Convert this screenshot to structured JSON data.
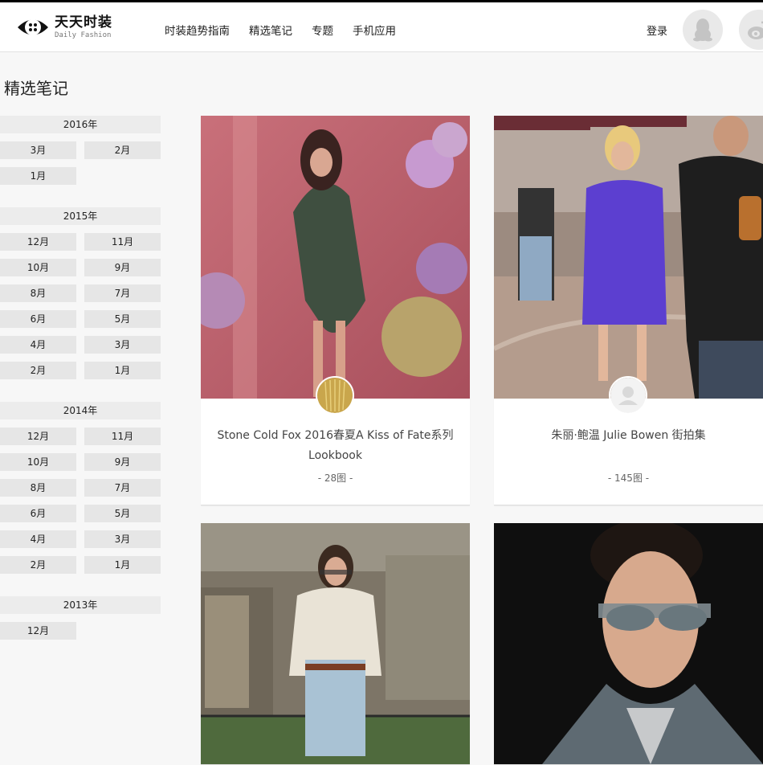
{
  "header": {
    "logo_cn": "天天时装",
    "logo_en": "Daily Fashion",
    "nav": [
      "时装趋势指南",
      "精选笔记",
      "专题",
      "手机应用"
    ],
    "login_label": "登录",
    "social_icons": [
      "qq-icon",
      "weibo-icon"
    ]
  },
  "page": {
    "title": "精选笔记"
  },
  "sidebar": {
    "years": [
      {
        "year": "2016年",
        "months": [
          "3月",
          "2月",
          "1月"
        ]
      },
      {
        "year": "2015年",
        "months": [
          "12月",
          "11月",
          "10月",
          "9月",
          "8月",
          "7月",
          "6月",
          "5月",
          "4月",
          "3月",
          "2月",
          "1月"
        ]
      },
      {
        "year": "2014年",
        "months": [
          "12月",
          "11月",
          "10月",
          "9月",
          "8月",
          "7月",
          "6月",
          "5月",
          "4月",
          "3月",
          "2月",
          "1月"
        ]
      },
      {
        "year": "2013年",
        "months": [
          "12月"
        ]
      }
    ]
  },
  "cards": [
    {
      "title": "Stone Cold Fox 2016春夏A Kiss of Fate系列 Lookbook",
      "count": "- 28图 -",
      "avatar": "gold-avatar"
    },
    {
      "title": "朱丽·鲍温 Julie Bowen 街拍集",
      "count": "- 145图 -",
      "avatar": "default-user-avatar"
    },
    {
      "title": "",
      "count": ""
    },
    {
      "title": "",
      "count": ""
    }
  ],
  "colors": {
    "accent": "#000000",
    "background": "#f7f7f7",
    "month_bg": "#e6e6e6"
  }
}
